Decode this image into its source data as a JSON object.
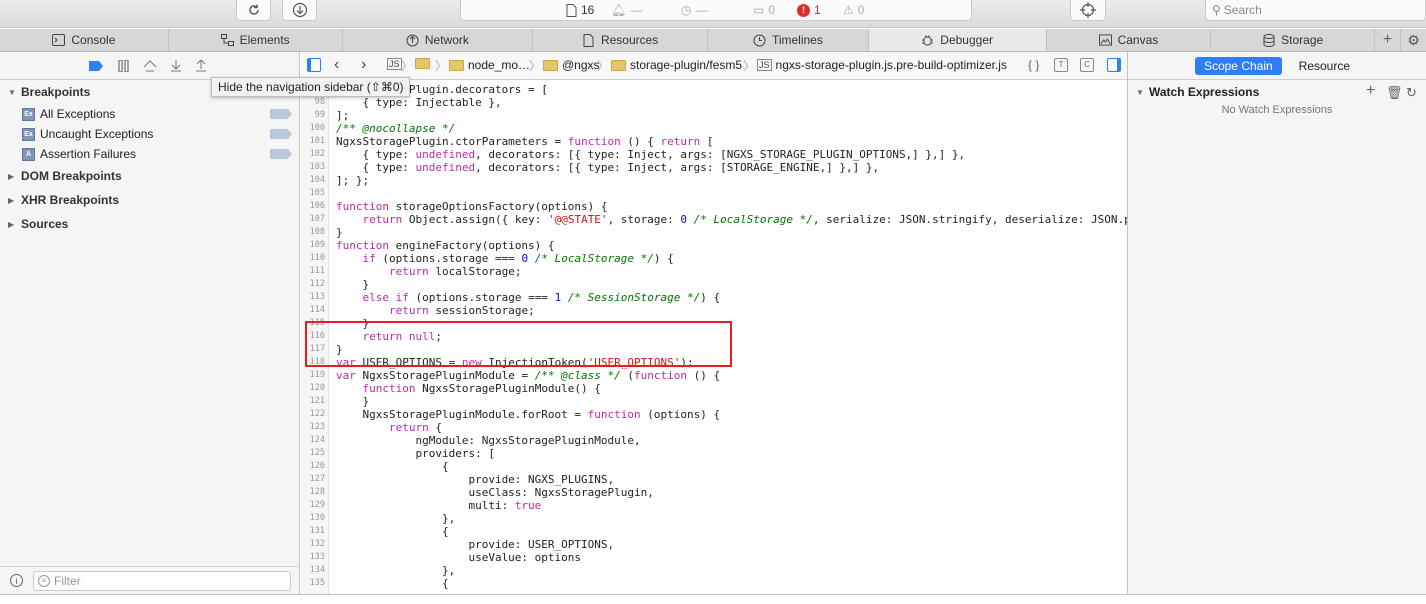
{
  "toolbar": {
    "resources_count": "16",
    "activity_dash1": "—",
    "activity_dash2": "—",
    "warnings_count": "0",
    "errors_count": "1",
    "logs_count": "0",
    "search_placeholder": "Search"
  },
  "tabs": [
    {
      "label": "Console",
      "icon": "console-icon"
    },
    {
      "label": "Elements",
      "icon": "elements-icon"
    },
    {
      "label": "Network",
      "icon": "network-icon"
    },
    {
      "label": "Resources",
      "icon": "resources-icon"
    },
    {
      "label": "Timelines",
      "icon": "timelines-icon"
    },
    {
      "label": "Debugger",
      "icon": "debugger-icon",
      "active": true
    },
    {
      "label": "Canvas",
      "icon": "canvas-icon"
    },
    {
      "label": "Storage",
      "icon": "storage-icon"
    }
  ],
  "sidebar": {
    "breakpoints_title": "Breakpoints",
    "breakpoints": [
      {
        "label": "All Exceptions",
        "icon_text": "Ex"
      },
      {
        "label": "Uncaught Exceptions",
        "icon_text": "Ex"
      },
      {
        "label": "Assertion Failures",
        "icon_text": "A"
      }
    ],
    "dom_breakpoints": "DOM Breakpoints",
    "xhr_breakpoints": "XHR Breakpoints",
    "sources": "Sources",
    "filter_placeholder": "Filter"
  },
  "tooltip": "Hide the navigation sidebar (⇧⌘0)",
  "breadcrumbs": {
    "node_modules": "node_mo…",
    "ngxs": "@ngxs",
    "plugin": "storage-plugin/fesm5",
    "file": "ngxs-storage-plugin.js.pre-build-optimizer.js"
  },
  "details": {
    "tab_scope": "Scope Chain",
    "tab_resource": "Resource",
    "watch_title": "Watch Expressions",
    "watch_empty": "No Watch Expressions"
  },
  "code": [
    {
      "n": "97",
      "html": "NgxsStoragePlugin.decorators = ["
    },
    {
      "n": "98",
      "html": "    { type: Injectable },"
    },
    {
      "n": "99",
      "html": "];"
    },
    {
      "n": "100",
      "html": "<span class='cm'>/** @nocollapse */</span>"
    },
    {
      "n": "101",
      "html": "NgxsStoragePlugin.ctorParameters = <span class='kw'>function</span> () { <span class='kw'>return</span> ["
    },
    {
      "n": "102",
      "html": "    { type: <span class='lit'>undefined</span>, decorators: [{ type: Inject, args: [NGXS_STORAGE_PLUGIN_OPTIONS,] },] },"
    },
    {
      "n": "103",
      "html": "    { type: <span class='lit'>undefined</span>, decorators: [{ type: Inject, args: [STORAGE_ENGINE,] },] },"
    },
    {
      "n": "104",
      "html": "]; };"
    },
    {
      "n": "105",
      "html": ""
    },
    {
      "n": "106",
      "html": "<span class='kw'>function</span> storageOptionsFactory(options) {"
    },
    {
      "n": "107",
      "html": "    <span class='kw'>return</span> Object.assign({ key: <span class='str'>'@@STATE'</span>, storage: <span class='num'>0</span> <span class='cm'>/* LocalStorage */</span>, serialize: JSON.stringify, deserialize: JSON.p"
    },
    {
      "n": "108",
      "html": "}"
    },
    {
      "n": "109",
      "html": "<span class='kw'>function</span> engineFactory(options) {"
    },
    {
      "n": "110",
      "html": "    <span class='kw'>if</span> (options.storage === <span class='num'>0</span> <span class='cm'>/* LocalStorage */</span>) {"
    },
    {
      "n": "111",
      "html": "        <span class='kw'>return</span> localStorage;"
    },
    {
      "n": "112",
      "html": "    }"
    },
    {
      "n": "113",
      "html": "    <span class='kw'>else if</span> (options.storage === <span class='num'>1</span> <span class='cm'>/* SessionStorage */</span>) {"
    },
    {
      "n": "114",
      "html": "        <span class='kw'>return</span> sessionStorage;"
    },
    {
      "n": "115",
      "html": "    }"
    },
    {
      "n": "116",
      "html": "    <span class='kw'>return</span> <span class='lit'>null</span>;"
    },
    {
      "n": "117",
      "html": "}"
    },
    {
      "n": "118",
      "html": "<span class='kw'>var</span> USER_OPTIONS = <span class='kw'>new</span> InjectionToken(<span class='str'>'USER_OPTIONS'</span>);"
    },
    {
      "n": "119",
      "html": "<span class='kw'>var</span> NgxsStoragePluginModule = <span class='cm'>/** @class */</span> (<span class='kw'>function</span> () {"
    },
    {
      "n": "120",
      "html": "    <span class='kw'>function</span> NgxsStoragePluginModule() {"
    },
    {
      "n": "121",
      "html": "    }"
    },
    {
      "n": "122",
      "html": "    NgxsStoragePluginModule.forRoot = <span class='kw'>function</span> (options) {"
    },
    {
      "n": "123",
      "html": "        <span class='kw'>return</span> {"
    },
    {
      "n": "124",
      "html": "            ngModule: NgxsStoragePluginModule,"
    },
    {
      "n": "125",
      "html": "            providers: ["
    },
    {
      "n": "126",
      "html": "                {"
    },
    {
      "n": "127",
      "html": "                    provide: NGXS_PLUGINS,"
    },
    {
      "n": "128",
      "html": "                    useClass: NgxsStoragePlugin,"
    },
    {
      "n": "129",
      "html": "                    multi: <span class='lit'>true</span>"
    },
    {
      "n": "130",
      "html": "                },"
    },
    {
      "n": "131",
      "html": "                {"
    },
    {
      "n": "132",
      "html": "                    provide: USER_OPTIONS,"
    },
    {
      "n": "133",
      "html": "                    useValue: options"
    },
    {
      "n": "134",
      "html": "                },"
    },
    {
      "n": "135",
      "html": "                {"
    }
  ]
}
